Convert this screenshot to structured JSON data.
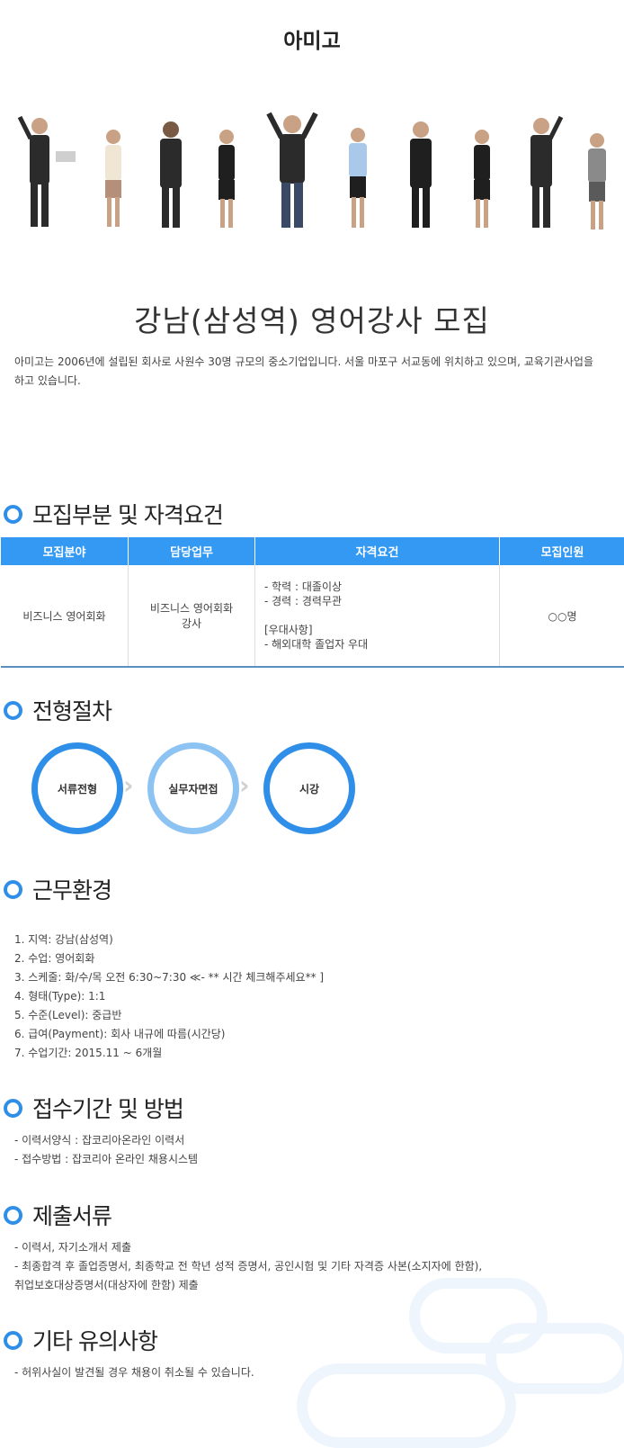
{
  "company": "아미고",
  "title": "강남(삼성역) 영어강사 모집",
  "intro": "아미고는 2006년에 설립된 회사로 사원수 30명 규모의 중소기업입니다. 서울 마포구 서교동에 위치하고 있으며, 교육기관사업을\n하고 있습니다.",
  "sections": {
    "recruit": "모집부분 및 자격요건",
    "process": "전형절차",
    "environment": "근무환경",
    "apply": "접수기간 및 방법",
    "documents": "제출서류",
    "notes": "기타 유의사항"
  },
  "table": {
    "headers": [
      "모집분야",
      "담당업무",
      "자격요건",
      "모집인원"
    ],
    "field": "비즈니스 영어회화",
    "duty_line1": "비즈니스 영어회화",
    "duty_line2": "강사",
    "qualifications": [
      "- 학력 : 대졸이상",
      "- 경력 : 경력무관",
      "",
      "[우대사항]",
      "- 해외대학 졸업자 우대"
    ],
    "count": "○○명"
  },
  "steps": [
    "서류전형",
    "실무자면접",
    "시강"
  ],
  "environment": [
    "1. 지역: 강남(삼성역)",
    "2. 수업: 영어회화",
    "3. 스케줄: 화/수/목 오전 6:30~7:30 ≪- ** 시간 체크해주세요** ]",
    "4. 형태(Type): 1:1",
    "5. 수준(Level): 중급반",
    "6. 급여(Payment): 회사 내규에 따름(시간당)",
    "7. 수업기간: 2015.11 ~ 6개월"
  ],
  "apply": [
    "- 이력서양식 : 잡코리아온라인 이력서",
    "- 접수방법 : 잡코리아 온라인 채용시스템"
  ],
  "documents": [
    "- 이력서, 자기소개서 제출",
    "- 최종합격 후 졸업증명서, 최종학교 전 학년 성적 증명서, 공인시험 및 기타 자격증 사본(소지자에 한함),",
    "취업보호대상증명서(대상자에 한함) 제출"
  ],
  "notes": [
    "- 허위사실이 발견될 경우 채용이 취소될 수 있습니다."
  ],
  "colors": {
    "accent": "#2f8fe8",
    "table_header": "#3399f3"
  }
}
